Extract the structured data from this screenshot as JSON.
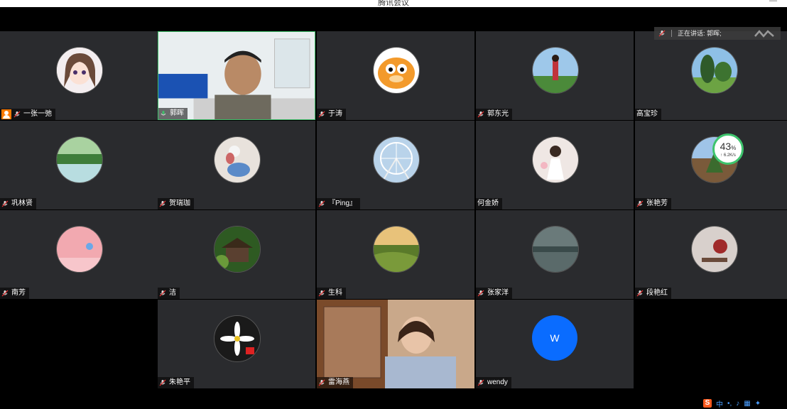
{
  "window": {
    "title": "腾讯会议",
    "controls": "—"
  },
  "speaking_indicator": {
    "label": "正在讲话: 郭晖;"
  },
  "network": {
    "percent": "43",
    "percent_unit": "%",
    "speed": "↑ 6.2K/s"
  },
  "participants": [
    {
      "name": "一张一弛"
    },
    {
      "name": "郭晖"
    },
    {
      "name": "于涛"
    },
    {
      "name": "郭东光"
    },
    {
      "name": "高宝珍"
    },
    {
      "name": "巩林贤"
    },
    {
      "name": "贺瑞珈"
    },
    {
      "name": "『Ping』"
    },
    {
      "name": "何金娇"
    },
    {
      "name": "张艳芳"
    },
    {
      "name": "南芳"
    },
    {
      "name": "洁"
    },
    {
      "name": "生科"
    },
    {
      "name": "张家洋"
    },
    {
      "name": "段艳红"
    },
    {
      "name": "朱艳平"
    },
    {
      "name": "雷海燕"
    },
    {
      "name": "wendy",
      "avatar_letter": "W"
    }
  ],
  "tray": {
    "ime": "S",
    "ime_lang": "中"
  },
  "colors": {
    "tile_bg": "#2a2b2e",
    "active_border": "#3fbf6a",
    "letter_avatar": "#0a6cff",
    "host_badge": "#ff7a00"
  }
}
